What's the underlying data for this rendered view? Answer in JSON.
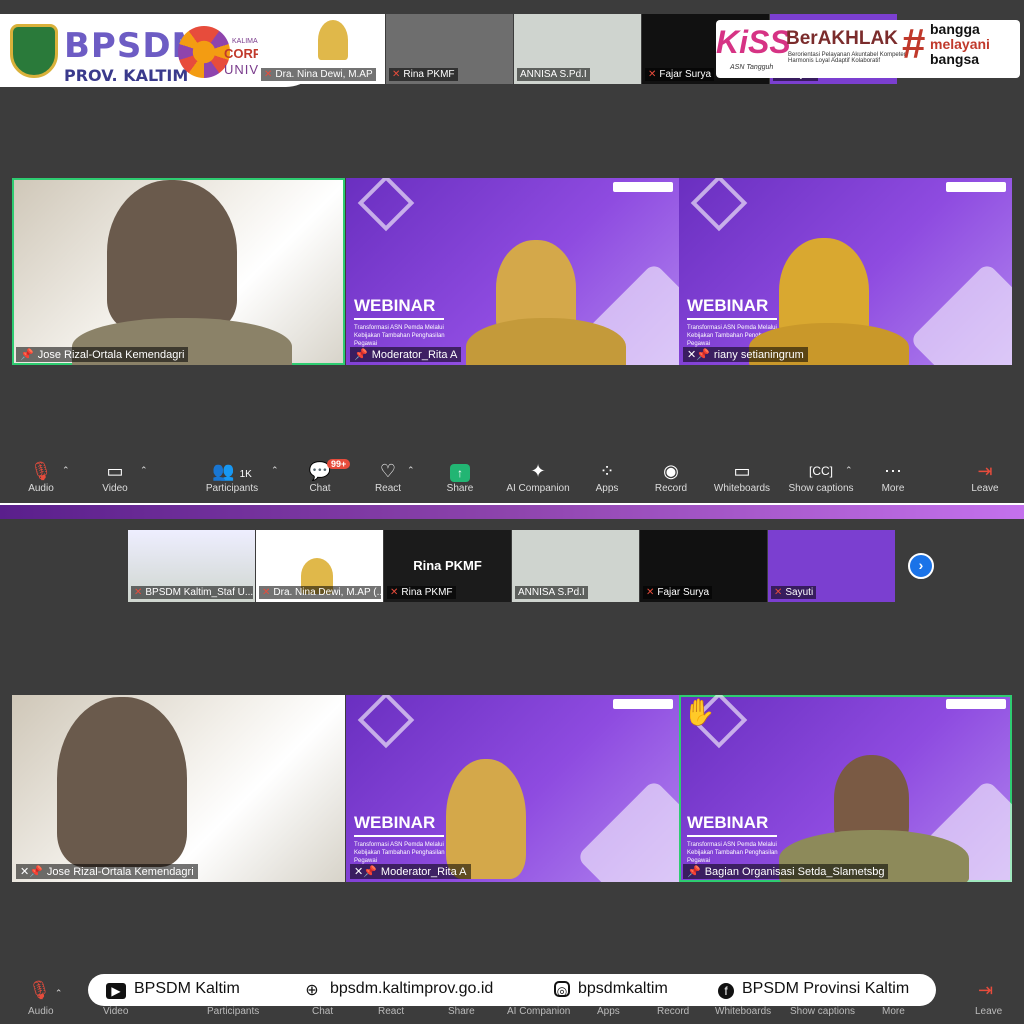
{
  "branding": {
    "bpsdm": "BPSDM",
    "prov": "PROV. KALTIM",
    "cu_small": "KALIMANTAN TIMUR",
    "cu_line1": "CORPORATE",
    "cu_line2": "UNIVERSITY",
    "kiss": "KiSS",
    "kiss_sub": "ASN Tangguh",
    "berakhlak": "BerAKHLAK",
    "berakhlak_sub": "Berorientasi Pelayanan Akuntabel Kompeten Harmonis Loyal Adaptif Kolaboratif",
    "hash": "#",
    "bangga1": "bangga",
    "bangga2": "melayani",
    "bangga3": "bangsa"
  },
  "top_strip": [
    "Dra. Nina Dewi, M.AP",
    "Rina PKMF",
    "ANNISA S.Pd.I",
    "Fajar Surya",
    "Sayuti"
  ],
  "view1": {
    "tiles": [
      {
        "name": "Jose Rizal-Ortala Kemendagri"
      },
      {
        "name": "Moderator_Rita A",
        "webinar": "WEBINAR",
        "subtitle": "Transformasi ASN Pemda Melalui Kebijakan Tambahan Penghasilan Pegawai"
      },
      {
        "name": "riany setianingrum",
        "webinar": "WEBINAR",
        "subtitle": "Transformasi ASN Pemda Melalui Kebijakan Tambahan Penghasilan Pegawai"
      }
    ]
  },
  "toolbar": {
    "audio": "Audio",
    "video": "Video",
    "participants": "Participants",
    "participants_count": "1K",
    "chat": "Chat",
    "chat_badge": "99+",
    "react": "React",
    "share": "Share",
    "ai": "AI Companion",
    "apps": "Apps",
    "record": "Record",
    "whiteboards": "Whiteboards",
    "captions": "Show captions",
    "more": "More",
    "leave": "Leave"
  },
  "strip2": {
    "thumbs": [
      "BPSDM Kaltim_Staf U...",
      "Dra. Nina Dewi, M.AP (...",
      "Rina PKMF",
      "ANNISA S.Pd.I",
      "Fajar Surya",
      "Sayuti"
    ],
    "rina_big": "Rina PKMF"
  },
  "view2": {
    "tiles": [
      {
        "name": "Jose Rizal-Ortala Kemendagri"
      },
      {
        "name": "Moderator_Rita A",
        "webinar": "WEBINAR",
        "subtitle": "Transformasi ASN Pemda Melalui Kebijakan Tambahan Penghasilan Pegawai"
      },
      {
        "name": "Bagian Organisasi Setda_Slametsbg",
        "webinar": "WEBINAR",
        "subtitle": "Transformasi ASN Pemda Melalui Kebijakan Tambahan Penghasilan Pegawai"
      }
    ]
  },
  "footer": {
    "youtube": "BPSDM Kaltim",
    "web": "bpsdm.kaltimprov.go.id",
    "instagram": "bpsdmkaltim",
    "facebook": "BPSDM Provinsi Kaltim"
  },
  "colors": {
    "accent": "#2ecc71",
    "danger": "#e74c3c",
    "purple": "#7b3fd0"
  }
}
